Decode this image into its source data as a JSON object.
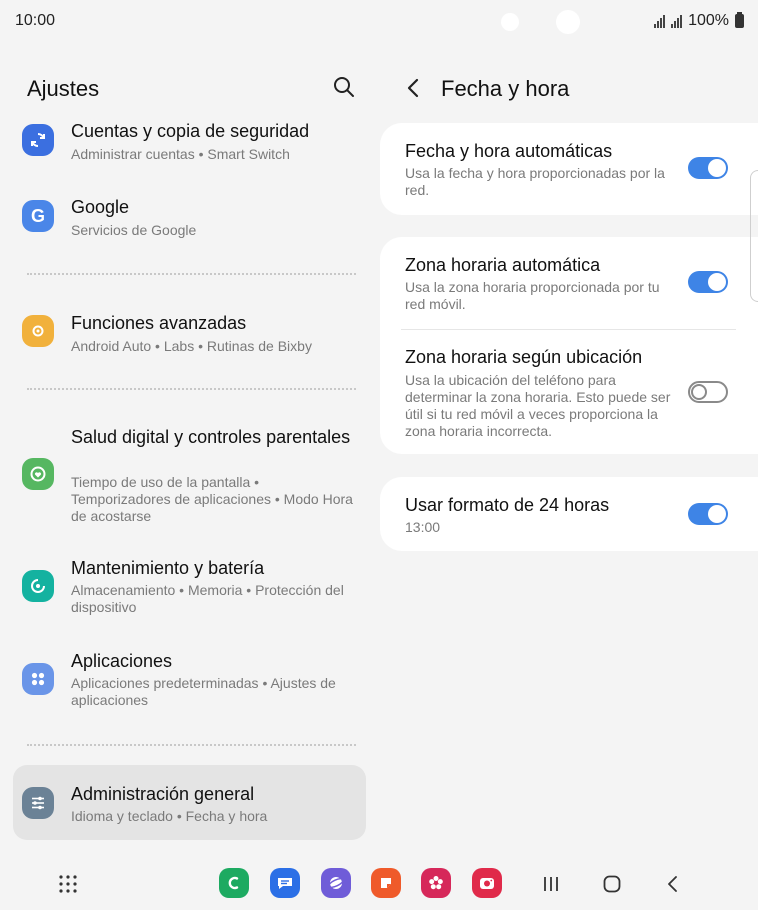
{
  "status": {
    "time": "10:00",
    "battery": "100%"
  },
  "left": {
    "title": "Ajustes",
    "items": [
      {
        "title": "Cuentas y copia de seguridad",
        "subtitle": "Administrar cuentas  •  Smart Switch",
        "icon": "sync-icon",
        "color": "#3b6fe0"
      },
      {
        "title": "Google",
        "subtitle": "Servicios de Google",
        "icon": "google-icon",
        "color": "#4a86e8"
      },
      {
        "title": "Funciones avanzadas",
        "subtitle": "Android Auto  •  Labs  •  Rutinas de Bixby",
        "icon": "puzzle-gear-icon",
        "color": "#f1b13c"
      },
      {
        "title": "Salud digital y controles parentales",
        "subtitle": "Tiempo de uso de la pantalla  •  Temporizadores de aplicaciones  •  Modo Hora de acostarse",
        "icon": "wellbeing-icon",
        "color": "#56b761"
      },
      {
        "title": "Mantenimiento y batería",
        "subtitle": "Almacenamiento  •  Memoria  •  Protección del dispositivo",
        "icon": "device-care-icon",
        "color": "#14b2a0"
      },
      {
        "title": "Aplicaciones",
        "subtitle": "Aplicaciones predeterminadas  •  Ajustes de aplicaciones",
        "icon": "apps-grid-icon",
        "color": "#6a95e8"
      },
      {
        "title": "Administración general",
        "subtitle": "Idioma y teclado  •  Fecha y hora",
        "icon": "sliders-icon",
        "color": "#6b8296"
      }
    ]
  },
  "right": {
    "title": "Fecha y hora",
    "auto_datetime": {
      "title": "Fecha y hora automáticas",
      "subtitle": "Usa la fecha y hora proporcionadas por la red.",
      "on": true
    },
    "auto_zone": {
      "title": "Zona horaria automática",
      "subtitle": "Usa la zona horaria proporcionada por tu red móvil.",
      "on": true
    },
    "zone_location": {
      "title": "Zona horaria según ubicación",
      "subtitle": "Usa la ubicación del teléfono para determinar la zona horaria. Esto puede ser útil si tu red móvil a veces proporciona la zona horaria incorrecta.",
      "on": false
    },
    "format24": {
      "title": "Usar formato de 24 horas",
      "subtitle": "13:00",
      "on": true
    }
  },
  "nav": {
    "apps": [
      {
        "name": "phone-icon",
        "color": "#1daa61"
      },
      {
        "name": "messages-icon",
        "color": "#2b6fe6"
      },
      {
        "name": "internet-icon",
        "color": "#6f5cd8"
      },
      {
        "name": "notes-icon",
        "color": "#ef5a2a"
      },
      {
        "name": "gallery-icon",
        "color": "#d6285a"
      },
      {
        "name": "camera-icon",
        "color": "#e02a4a"
      }
    ]
  }
}
